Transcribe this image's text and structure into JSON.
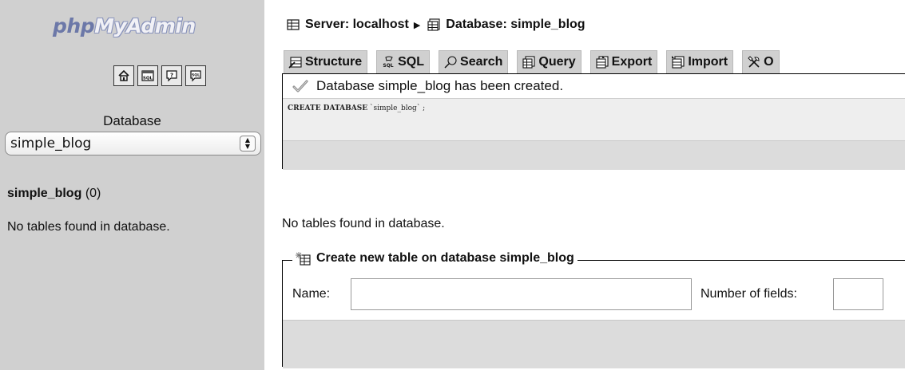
{
  "left": {
    "logo": {
      "part1": "php",
      "part2": "MyAdmin"
    },
    "quick_icons": [
      "home-icon",
      "sql-window-icon",
      "help-icon",
      "sql-docs-icon"
    ],
    "db_label": "Database",
    "db_select": {
      "selected": "simple_blog"
    },
    "db_name": "simple_blog",
    "db_count": "(0)",
    "no_tables": "No tables found in database."
  },
  "breadcrumb": {
    "server": "Server: localhost",
    "database": "Database: simple_blog"
  },
  "tabs": [
    {
      "label": "Structure",
      "icon": "structure-icon"
    },
    {
      "label": "SQL",
      "icon": "sql-icon"
    },
    {
      "label": "Search",
      "icon": "search-icon"
    },
    {
      "label": "Query",
      "icon": "query-icon"
    },
    {
      "label": "Export",
      "icon": "export-icon"
    },
    {
      "label": "Import",
      "icon": "import-icon"
    },
    {
      "label": "O",
      "icon": "operations-icon"
    }
  ],
  "message": {
    "notice": "Database simple_blog has been created.",
    "sql_keyword": "CREATE DATABASE",
    "sql_rest": "`simple_blog` ;"
  },
  "main": {
    "no_tables": "No tables found in database."
  },
  "create_table": {
    "legend": "Create new table on database simple_blog",
    "name_label": "Name:",
    "name_value": "",
    "fields_label": "Number of fields:",
    "fields_value": ""
  }
}
